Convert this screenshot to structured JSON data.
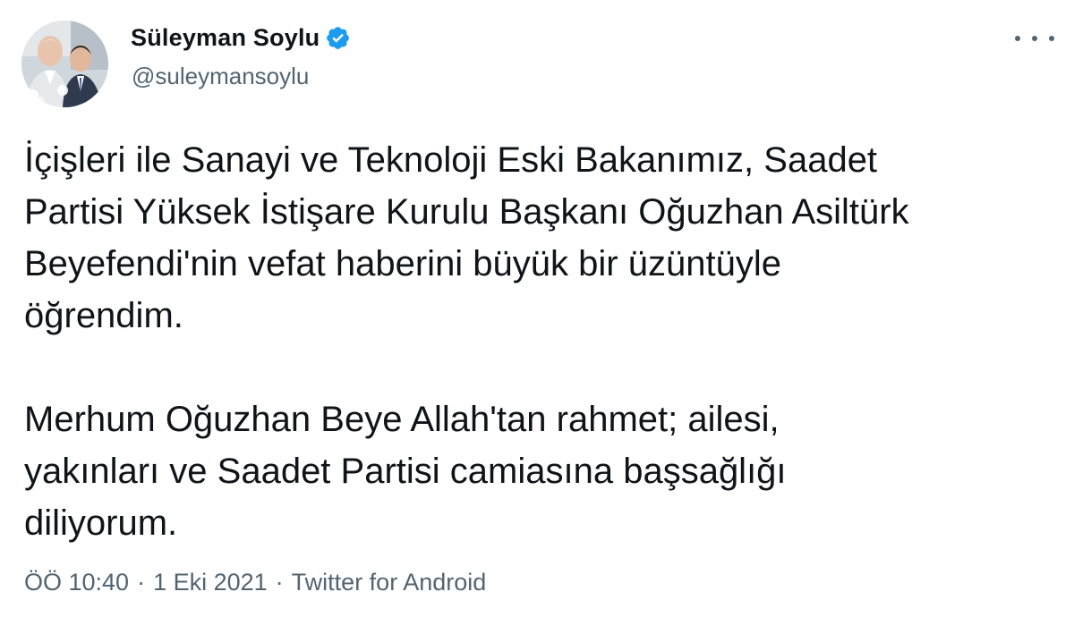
{
  "author": {
    "display_name": "Süleyman Soylu",
    "handle": "@suleymansoylu",
    "verified": true,
    "verified_icon": "verified-badge-icon",
    "avatar_icon": "profile-photo",
    "more_icon": "more-options-icon"
  },
  "tweet": {
    "paragraphs": [
      "İçişleri ile Sanayi ve Teknoloji Eski Bakanımız, Saadet\nPartisi Yüksek İstişare Kurulu Başkanı Oğuzhan Asiltürk\nBeyefendi'nin vefat haberini büyük bir üzüntüyle\nöğrendim.",
      "Merhum Oğuzhan Beye Allah'tan rahmet; ailesi,\nyakınları ve Saadet Partisi camiasına başsağlığı\ndiliyorum."
    ],
    "time": "ÖÖ 10:40",
    "date": "1 Eki 2021",
    "source": "Twitter for Android",
    "separator": "·"
  },
  "colors": {
    "text_primary": "#0f1419",
    "text_secondary": "#536471",
    "verified_blue": "#1d9bf0",
    "background": "#ffffff"
  }
}
